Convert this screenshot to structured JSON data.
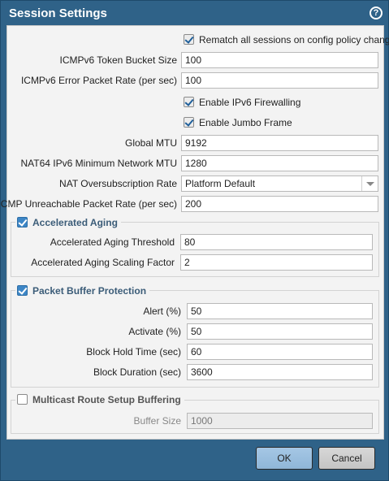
{
  "dialog": {
    "title": "Session Settings",
    "help_glyph": "?"
  },
  "options": {
    "rematch_label": "Rematch all sessions on config policy change",
    "rematch_checked": true,
    "token_bucket_label": "ICMPv6 Token Bucket Size",
    "token_bucket_value": "100",
    "error_rate_label": "ICMPv6 Error Packet Rate (per sec)",
    "error_rate_value": "100",
    "ipv6_fw_label": "Enable IPv6 Firewalling",
    "ipv6_fw_checked": true,
    "jumbo_label": "Enable Jumbo Frame",
    "jumbo_checked": true,
    "global_mtu_label": "Global MTU",
    "global_mtu_value": "9192",
    "nat64_mtu_label": "NAT64 IPv6 Minimum Network MTU",
    "nat64_mtu_value": "1280",
    "nat_oversub_label": "NAT Oversubscription Rate",
    "nat_oversub_value": "Platform Default",
    "icmp_unreach_label": "ICMP Unreachable Packet Rate (per sec)",
    "icmp_unreach_value": "200"
  },
  "accelerated_aging": {
    "title": "Accelerated Aging",
    "checked": true,
    "threshold_label": "Accelerated Aging Threshold",
    "threshold_value": "80",
    "scaling_label": "Accelerated Aging Scaling Factor",
    "scaling_value": "2"
  },
  "packet_buffer": {
    "title": "Packet Buffer Protection",
    "checked": true,
    "alert_label": "Alert (%)",
    "alert_value": "50",
    "activate_label": "Activate (%)",
    "activate_value": "50",
    "hold_label": "Block Hold Time (sec)",
    "hold_value": "60",
    "duration_label": "Block Duration (sec)",
    "duration_value": "3600"
  },
  "multicast": {
    "title": "Multicast Route Setup Buffering",
    "checked": false,
    "buffer_label": "Buffer Size",
    "buffer_value": "1000"
  },
  "footer": {
    "ok_label": "OK",
    "cancel_label": "Cancel"
  },
  "colors": {
    "frame": "#2f6288",
    "panel": "#f3f3f3",
    "group_title": "#3b5c78",
    "checkbox_blue": "#3d86c6",
    "ok_button": "#9bbfdf"
  }
}
